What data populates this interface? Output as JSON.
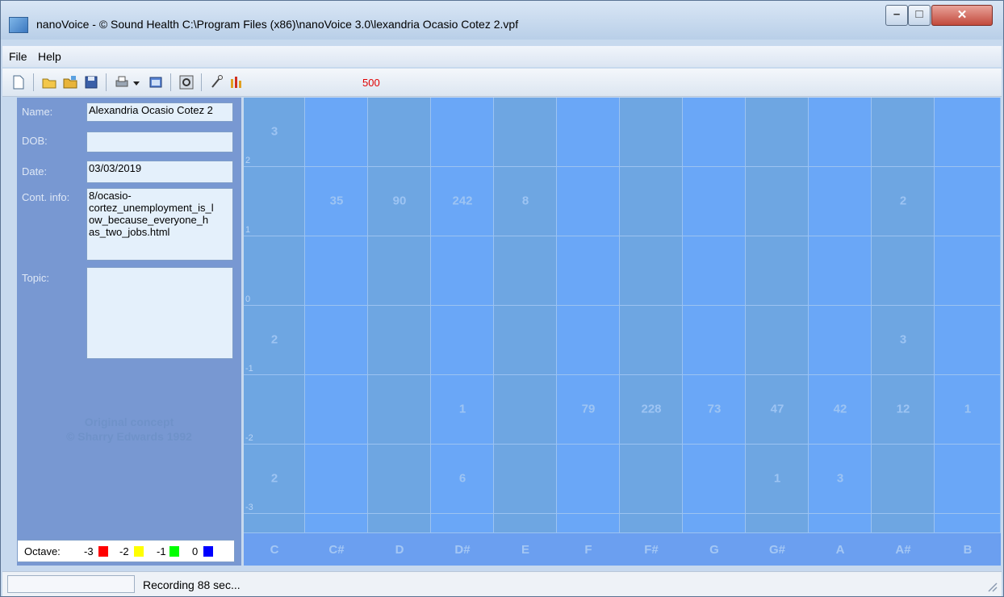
{
  "window": {
    "title": "nanoVoice - © Sound Health C:\\Program Files (x86)\\nanoVoice 3.0\\lexandria  Ocasio Cotez 2.vpf"
  },
  "menu": [
    "File",
    "Help"
  ],
  "toolbar": {
    "icons": [
      "new-file-icon",
      "open-icon",
      "open-folder-icon",
      "save-icon",
      "print-icon",
      "dropdown-icon",
      "window-icon",
      "settings-icon",
      "microphone-icon",
      "bar-chart-icon"
    ],
    "counter": "500"
  },
  "form": {
    "name_label": "Name:",
    "name_value": "Alexandria  Ocasio Cotez 2",
    "dob_label": "DOB:",
    "dob_value": "",
    "date_label": "Date:",
    "date_value": "03/03/2019",
    "contact_label": "Cont. info:",
    "contact_value": "8/ocasio-\ncortez_unemployment_is_l\now_because_everyone_h\nas_two_jobs.html",
    "topic_label": "Topic:",
    "topic_value": ""
  },
  "credit": {
    "line1": "Original concept",
    "line2": "© Sharry Edwards 1992"
  },
  "octave_legend": {
    "label": "Octave:",
    "items": [
      {
        "label": "-3",
        "color": "#ff0000"
      },
      {
        "label": "-2",
        "color": "#ffff00"
      },
      {
        "label": "-1",
        "color": "#00ff00"
      },
      {
        "label": "0",
        "color": "#0000ff"
      }
    ]
  },
  "grid": {
    "notes": [
      "C",
      "C#",
      "D",
      "D#",
      "E",
      "F",
      "F#",
      "G",
      "G#",
      "A",
      "A#",
      "B"
    ],
    "row_labels": [
      "2",
      "1",
      "0",
      "-1",
      "-2",
      "-3"
    ],
    "rows": [
      [
        "3",
        "",
        "",
        "",
        "",
        "",
        "",
        "",
        "",
        "",
        "",
        ""
      ],
      [
        "",
        "35",
        "90",
        "242",
        "8",
        "",
        "",
        "",
        "",
        "",
        "2",
        ""
      ],
      [
        "",
        "",
        "",
        "",
        "",
        "",
        "",
        "",
        "",
        "",
        "",
        ""
      ],
      [
        "2",
        "",
        "",
        "",
        "",
        "",
        "",
        "",
        "",
        "",
        "3",
        ""
      ],
      [
        "",
        "",
        "",
        "1",
        "",
        "79",
        "228",
        "73",
        "47",
        "42",
        "12",
        "1"
      ],
      [
        "2",
        "",
        "",
        "6",
        "",
        "",
        "",
        "",
        "1",
        "3",
        "",
        ""
      ]
    ]
  },
  "status": {
    "text": "Recording 88 sec..."
  }
}
